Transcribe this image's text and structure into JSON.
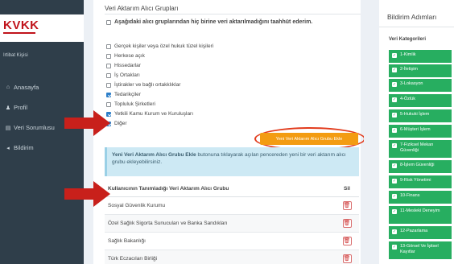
{
  "sidebar": {
    "logo": "KVKK",
    "company": "Irtibat Kişisi",
    "menu": [
      {
        "icon": "home-icon",
        "glyph": "⌂",
        "label": "Anasayfa"
      },
      {
        "icon": "user-icon",
        "glyph": "♟",
        "label": "Profil"
      },
      {
        "icon": "list-icon",
        "glyph": "▤",
        "label": "Veri Sorumlusu"
      },
      {
        "icon": "megaphone-icon",
        "glyph": "◂",
        "label": "Bildirim"
      }
    ]
  },
  "main": {
    "section_title": "Veri Aktarım Alıcı Grupları",
    "pledge": "Aşağıdaki alıcı gruplarından hiç birine veri aktarılmadığını taahhüt ederim.",
    "groups": [
      {
        "label": "Gerçek kişiler veya özel hukuk tüzel kişileri",
        "checked": false
      },
      {
        "label": "Herkese açık",
        "checked": false
      },
      {
        "label": "Hissedarlar",
        "checked": false
      },
      {
        "label": "İş Ortakları",
        "checked": false
      },
      {
        "label": "İştirakler ve bağlı ortakklıklar",
        "checked": false
      },
      {
        "label": "Tedarikçiler",
        "checked": true
      },
      {
        "label": "Topluluk Şirketleri",
        "checked": false
      },
      {
        "label": "Yetkili Kamu Kurum ve Kuruluşları",
        "checked": true
      },
      {
        "label": "Diğer",
        "checked": true
      }
    ],
    "add_button": "Yeni Veri Aktarım Alıcı Grubu Ekle",
    "info": {
      "bold": "Yeni Veri Aktarım Alıcı Grubu Ekle",
      "rest": " butonuna tıklayarak açılan pencereden yeni bir veri aktarım alıcı grubu ekleyebilirsiniz."
    },
    "table": {
      "headers": [
        "Kullanıcının Tanımladığı Veri Aktarım Alıcı Grubu",
        "Sil"
      ],
      "rows": [
        "Sosyal Güvenlik Kurumu",
        "Özel Sağlık Sigorta Sunucuları ve Banka Sandıkları",
        "Sağlık Bakanlığı",
        "Türk Eczacıları Birliği"
      ]
    }
  },
  "steps": {
    "title": "Bildirim Adımları",
    "subtitle": "Veri Kategorileri",
    "items": [
      "1-Kimlik",
      "2-İletişim",
      "3-Lokasyon",
      "4-Özlük",
      "5-Hukuki İşlem",
      "6-Müşteri İşlem",
      "7-Fiziksel Mekan Güvenliği",
      "8-İşlem Güvenliği",
      "9-Risk Yönetimi",
      "10-Finans",
      "11-Mesleki Deneyim",
      "12-Pazarlama",
      "13-Görsel Ve İşitsel Kayıtlar"
    ]
  },
  "colors": {
    "sidebar_bg": "#2f3e4a",
    "accent_orange": "#f39c12",
    "step_green": "#27ae60",
    "arrow_red": "#c8201b"
  }
}
